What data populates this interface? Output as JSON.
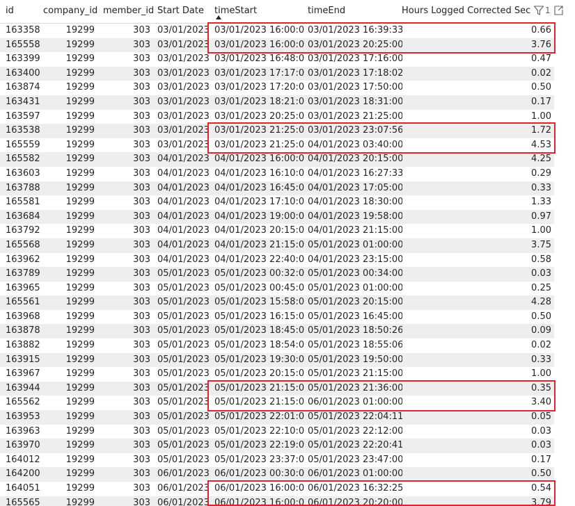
{
  "table": {
    "columns": {
      "id": "id",
      "company_id": "company_id",
      "member_id": "member_id",
      "start_date": "Start Date",
      "time_start": "timeStart",
      "time_end": "timeEnd",
      "hours": "Hours Logged Corrected Seco"
    },
    "sorted_column": "timeStart",
    "header_icons": {
      "filter": "filter-icon",
      "filter_count": "1",
      "focus": "focus-mode-icon"
    },
    "rows": [
      {
        "id": "163358",
        "company_id": "19299",
        "member_id": "303",
        "start_date": "03/01/2023",
        "time_start": "03/01/2023 16:00:00",
        "time_end": "03/01/2023 16:39:33",
        "hours": "0.66"
      },
      {
        "id": "165558",
        "company_id": "19299",
        "member_id": "303",
        "start_date": "03/01/2023",
        "time_start": "03/01/2023 16:00:00",
        "time_end": "03/01/2023 20:25:00",
        "hours": "3.76"
      },
      {
        "id": "163399",
        "company_id": "19299",
        "member_id": "303",
        "start_date": "03/01/2023",
        "time_start": "03/01/2023 16:48:00",
        "time_end": "03/01/2023 17:16:00",
        "hours": "0.47"
      },
      {
        "id": "163400",
        "company_id": "19299",
        "member_id": "303",
        "start_date": "03/01/2023",
        "time_start": "03/01/2023 17:17:00",
        "time_end": "03/01/2023 17:18:02",
        "hours": "0.02"
      },
      {
        "id": "163874",
        "company_id": "19299",
        "member_id": "303",
        "start_date": "03/01/2023",
        "time_start": "03/01/2023 17:20:00",
        "time_end": "03/01/2023 17:50:00",
        "hours": "0.50"
      },
      {
        "id": "163431",
        "company_id": "19299",
        "member_id": "303",
        "start_date": "03/01/2023",
        "time_start": "03/01/2023 18:21:00",
        "time_end": "03/01/2023 18:31:00",
        "hours": "0.17"
      },
      {
        "id": "163597",
        "company_id": "19299",
        "member_id": "303",
        "start_date": "03/01/2023",
        "time_start": "03/01/2023 20:25:00",
        "time_end": "03/01/2023 21:25:00",
        "hours": "1.00"
      },
      {
        "id": "163538",
        "company_id": "19299",
        "member_id": "303",
        "start_date": "03/01/2023",
        "time_start": "03/01/2023 21:25:00",
        "time_end": "03/01/2023 23:07:56",
        "hours": "1.72"
      },
      {
        "id": "165559",
        "company_id": "19299",
        "member_id": "303",
        "start_date": "03/01/2023",
        "time_start": "03/01/2023 21:25:00",
        "time_end": "04/01/2023 03:40:00",
        "hours": "4.53"
      },
      {
        "id": "165582",
        "company_id": "19299",
        "member_id": "303",
        "start_date": "04/01/2023",
        "time_start": "04/01/2023 16:00:00",
        "time_end": "04/01/2023 20:15:00",
        "hours": "4.25"
      },
      {
        "id": "163603",
        "company_id": "19299",
        "member_id": "303",
        "start_date": "04/01/2023",
        "time_start": "04/01/2023 16:10:00",
        "time_end": "04/01/2023 16:27:33",
        "hours": "0.29"
      },
      {
        "id": "163788",
        "company_id": "19299",
        "member_id": "303",
        "start_date": "04/01/2023",
        "time_start": "04/01/2023 16:45:00",
        "time_end": "04/01/2023 17:05:00",
        "hours": "0.33"
      },
      {
        "id": "165581",
        "company_id": "19299",
        "member_id": "303",
        "start_date": "04/01/2023",
        "time_start": "04/01/2023 17:10:00",
        "time_end": "04/01/2023 18:30:00",
        "hours": "1.33"
      },
      {
        "id": "163684",
        "company_id": "19299",
        "member_id": "303",
        "start_date": "04/01/2023",
        "time_start": "04/01/2023 19:00:00",
        "time_end": "04/01/2023 19:58:00",
        "hours": "0.97"
      },
      {
        "id": "163792",
        "company_id": "19299",
        "member_id": "303",
        "start_date": "04/01/2023",
        "time_start": "04/01/2023 20:15:00",
        "time_end": "04/01/2023 21:15:00",
        "hours": "1.00"
      },
      {
        "id": "165568",
        "company_id": "19299",
        "member_id": "303",
        "start_date": "04/01/2023",
        "time_start": "04/01/2023 21:15:00",
        "time_end": "05/01/2023 01:00:00",
        "hours": "3.75"
      },
      {
        "id": "163962",
        "company_id": "19299",
        "member_id": "303",
        "start_date": "04/01/2023",
        "time_start": "04/01/2023 22:40:00",
        "time_end": "04/01/2023 23:15:00",
        "hours": "0.58"
      },
      {
        "id": "163789",
        "company_id": "19299",
        "member_id": "303",
        "start_date": "05/01/2023",
        "time_start": "05/01/2023 00:32:00",
        "time_end": "05/01/2023 00:34:00",
        "hours": "0.03"
      },
      {
        "id": "163965",
        "company_id": "19299",
        "member_id": "303",
        "start_date": "05/01/2023",
        "time_start": "05/01/2023 00:45:00",
        "time_end": "05/01/2023 01:00:00",
        "hours": "0.25"
      },
      {
        "id": "165561",
        "company_id": "19299",
        "member_id": "303",
        "start_date": "05/01/2023",
        "time_start": "05/01/2023 15:58:00",
        "time_end": "05/01/2023 20:15:00",
        "hours": "4.28"
      },
      {
        "id": "163968",
        "company_id": "19299",
        "member_id": "303",
        "start_date": "05/01/2023",
        "time_start": "05/01/2023 16:15:00",
        "time_end": "05/01/2023 16:45:00",
        "hours": "0.50"
      },
      {
        "id": "163878",
        "company_id": "19299",
        "member_id": "303",
        "start_date": "05/01/2023",
        "time_start": "05/01/2023 18:45:00",
        "time_end": "05/01/2023 18:50:26",
        "hours": "0.09"
      },
      {
        "id": "163882",
        "company_id": "19299",
        "member_id": "303",
        "start_date": "05/01/2023",
        "time_start": "05/01/2023 18:54:00",
        "time_end": "05/01/2023 18:55:06",
        "hours": "0.02"
      },
      {
        "id": "163915",
        "company_id": "19299",
        "member_id": "303",
        "start_date": "05/01/2023",
        "time_start": "05/01/2023 19:30:00",
        "time_end": "05/01/2023 19:50:00",
        "hours": "0.33"
      },
      {
        "id": "163967",
        "company_id": "19299",
        "member_id": "303",
        "start_date": "05/01/2023",
        "time_start": "05/01/2023 20:15:00",
        "time_end": "05/01/2023 21:15:00",
        "hours": "1.00"
      },
      {
        "id": "163944",
        "company_id": "19299",
        "member_id": "303",
        "start_date": "05/01/2023",
        "time_start": "05/01/2023 21:15:00",
        "time_end": "05/01/2023 21:36:00",
        "hours": "0.35"
      },
      {
        "id": "165562",
        "company_id": "19299",
        "member_id": "303",
        "start_date": "05/01/2023",
        "time_start": "05/01/2023 21:15:00",
        "time_end": "06/01/2023 01:00:00",
        "hours": "3.40"
      },
      {
        "id": "163953",
        "company_id": "19299",
        "member_id": "303",
        "start_date": "05/01/2023",
        "time_start": "05/01/2023 22:01:00",
        "time_end": "05/01/2023 22:04:11",
        "hours": "0.05"
      },
      {
        "id": "163963",
        "company_id": "19299",
        "member_id": "303",
        "start_date": "05/01/2023",
        "time_start": "05/01/2023 22:10:00",
        "time_end": "05/01/2023 22:12:00",
        "hours": "0.03"
      },
      {
        "id": "163970",
        "company_id": "19299",
        "member_id": "303",
        "start_date": "05/01/2023",
        "time_start": "05/01/2023 22:19:00",
        "time_end": "05/01/2023 22:20:41",
        "hours": "0.03"
      },
      {
        "id": "164012",
        "company_id": "19299",
        "member_id": "303",
        "start_date": "05/01/2023",
        "time_start": "05/01/2023 23:37:00",
        "time_end": "05/01/2023 23:47:00",
        "hours": "0.17"
      },
      {
        "id": "164200",
        "company_id": "19299",
        "member_id": "303",
        "start_date": "06/01/2023",
        "time_start": "06/01/2023 00:30:00",
        "time_end": "06/01/2023 01:00:00",
        "hours": "0.50"
      },
      {
        "id": "164051",
        "company_id": "19299",
        "member_id": "303",
        "start_date": "06/01/2023",
        "time_start": "06/01/2023 16:00:00",
        "time_end": "06/01/2023 16:32:25",
        "hours": "0.54"
      },
      {
        "id": "165565",
        "company_id": "19299",
        "member_id": "303",
        "start_date": "06/01/2023",
        "time_start": "06/01/2023 16:00:00",
        "time_end": "06/01/2023 20:20:00",
        "hours": "3.79"
      }
    ],
    "highlight_color": "#e0242f",
    "highlighted_row_pairs": [
      [
        0,
        1
      ],
      [
        7,
        8
      ],
      [
        25,
        26
      ],
      [
        32,
        33
      ]
    ]
  }
}
